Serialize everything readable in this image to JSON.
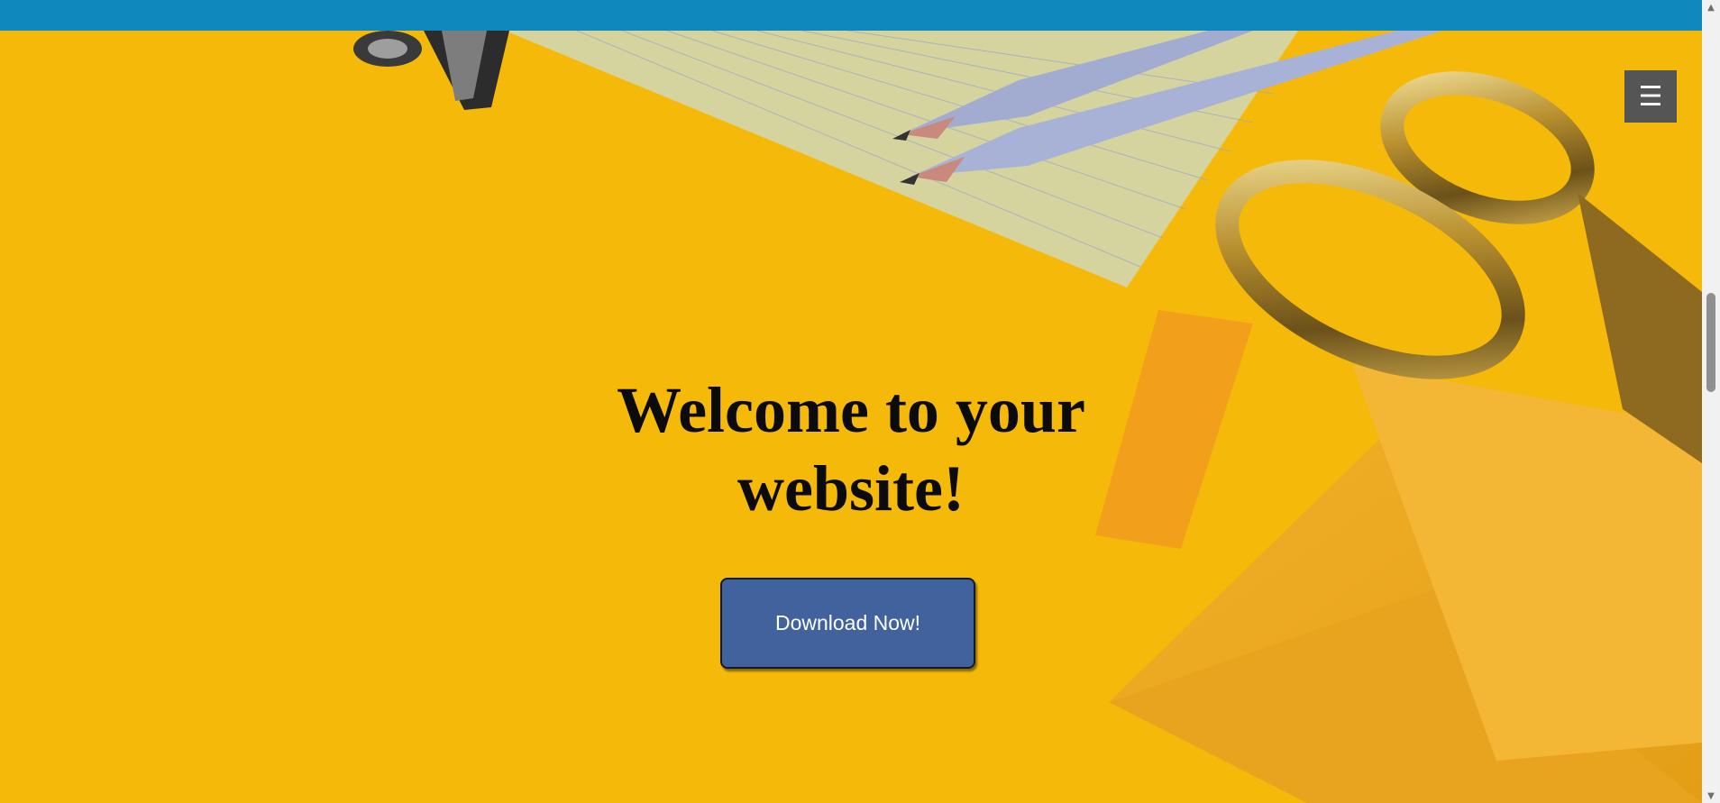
{
  "hero": {
    "title_line1": "Welcome to your",
    "title_line2": "website!",
    "button_label": "Download Now!",
    "background_color": "#f5b90a"
  },
  "header": {
    "bar_color": "#0f89bd"
  },
  "menu": {
    "icon": "hamburger-menu-icon",
    "glyph": "☰"
  },
  "scrollbar": {
    "up_glyph": "▲",
    "down_glyph": "▼"
  }
}
